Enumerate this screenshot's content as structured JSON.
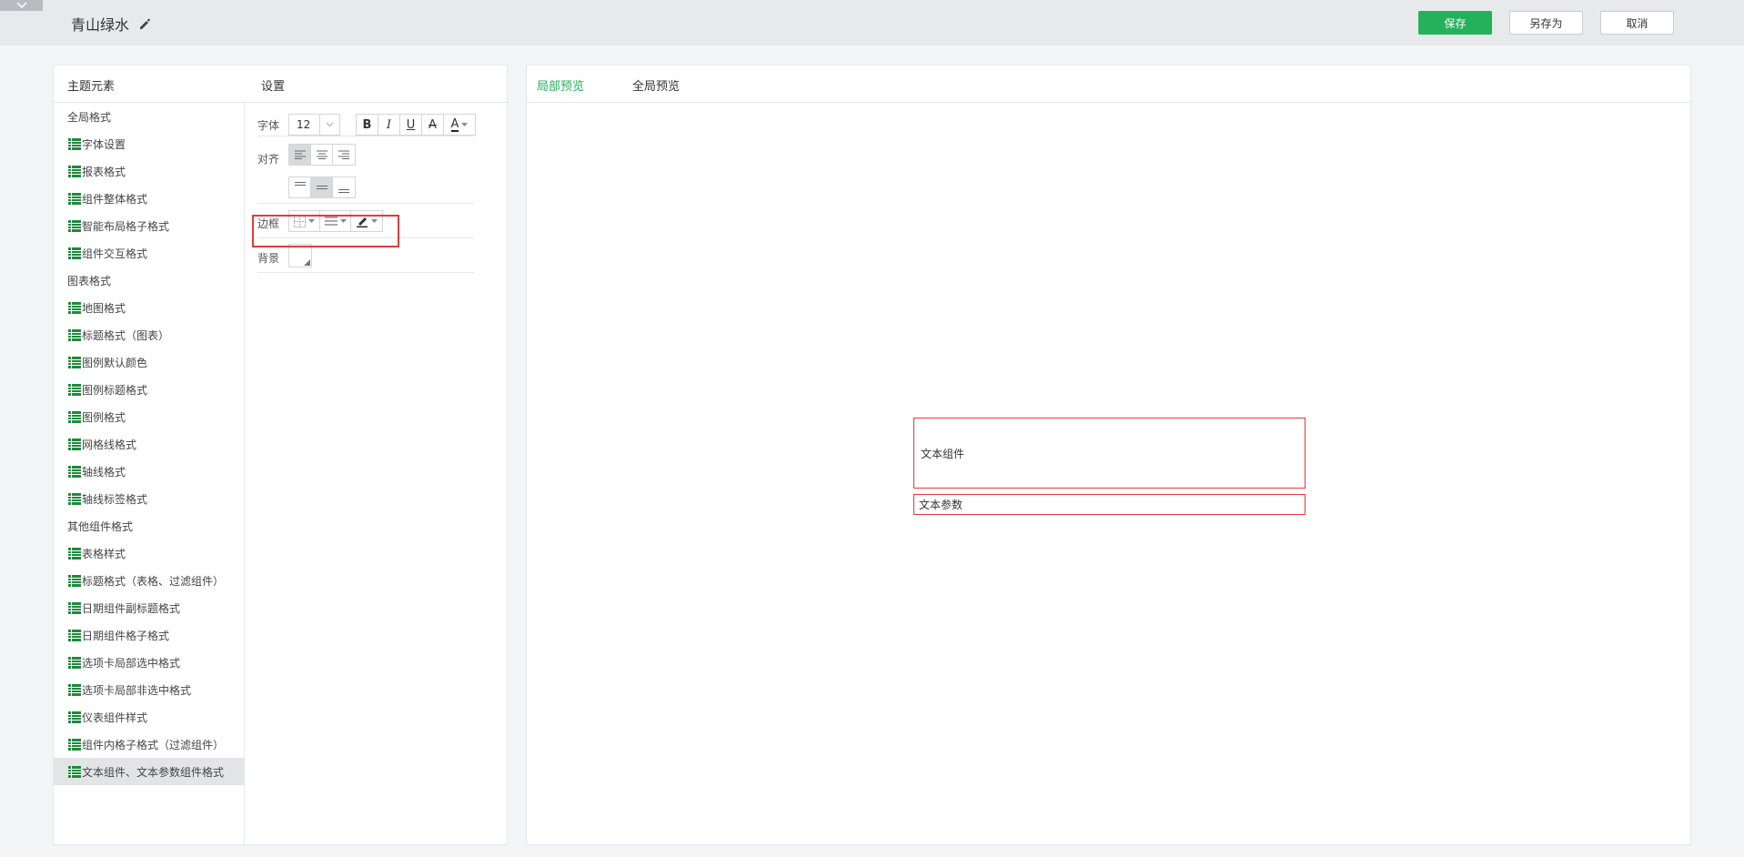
{
  "header": {
    "title": "青山绿水",
    "save_label": "保存",
    "saveas_label": "另存为",
    "cancel_label": "取消"
  },
  "left_panel": {
    "elements_heading": "主题元素",
    "settings_heading": "设置"
  },
  "tree": [
    {
      "label": "全局格式",
      "type": "group"
    },
    {
      "label": "字体设置",
      "type": "item"
    },
    {
      "label": "报表格式",
      "type": "item"
    },
    {
      "label": "组件整体格式",
      "type": "item"
    },
    {
      "label": "智能布局格子格式",
      "type": "item"
    },
    {
      "label": "组件交互格式",
      "type": "item"
    },
    {
      "label": "图表格式",
      "type": "group"
    },
    {
      "label": "地图格式",
      "type": "item"
    },
    {
      "label": "标题格式（图表）",
      "type": "item"
    },
    {
      "label": "图例默认颜色",
      "type": "item"
    },
    {
      "label": "图例标题格式",
      "type": "item"
    },
    {
      "label": "图例格式",
      "type": "item"
    },
    {
      "label": "网格线格式",
      "type": "item"
    },
    {
      "label": "轴线格式",
      "type": "item"
    },
    {
      "label": "轴线标签格式",
      "type": "item"
    },
    {
      "label": "其他组件格式",
      "type": "group"
    },
    {
      "label": "表格样式",
      "type": "item"
    },
    {
      "label": "标题格式（表格、过滤组件）",
      "type": "item"
    },
    {
      "label": "日期组件副标题格式",
      "type": "item"
    },
    {
      "label": "日期组件格子格式",
      "type": "item"
    },
    {
      "label": "选项卡局部选中格式",
      "type": "item"
    },
    {
      "label": "选项卡局部非选中格式",
      "type": "item"
    },
    {
      "label": "仪表组件样式",
      "type": "item"
    },
    {
      "label": "组件内格子格式（过滤组件）",
      "type": "item"
    },
    {
      "label": "文本组件、文本参数组件格式",
      "type": "item",
      "selected": true
    }
  ],
  "settings": {
    "font_label": "字体",
    "font_size": "12",
    "bold": "B",
    "italic": "I",
    "underline": "U",
    "strike": "A",
    "color": "A",
    "align_label": "对齐",
    "border_label": "边框",
    "background_label": "背景"
  },
  "preview": {
    "tab_local": "局部预览",
    "tab_global": "全局预览",
    "text_component": "文本组件",
    "text_param": "文本参数"
  },
  "colors": {
    "accent": "#25b05a",
    "highlight": "#e23b3b"
  }
}
